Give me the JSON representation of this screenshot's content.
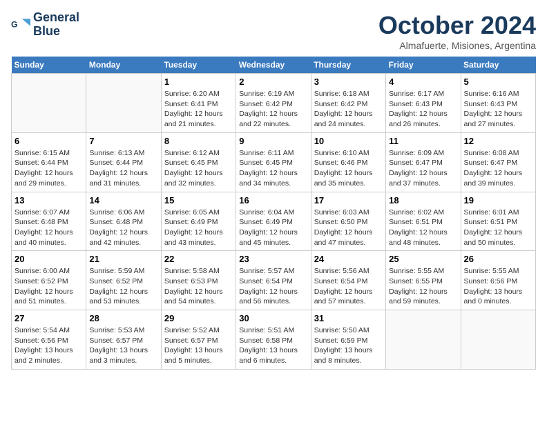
{
  "header": {
    "logo_line1": "General",
    "logo_line2": "Blue",
    "month": "October 2024",
    "location": "Almafuerte, Misiones, Argentina"
  },
  "days_of_week": [
    "Sunday",
    "Monday",
    "Tuesday",
    "Wednesday",
    "Thursday",
    "Friday",
    "Saturday"
  ],
  "weeks": [
    [
      {
        "day": "",
        "empty": true
      },
      {
        "day": "",
        "empty": true
      },
      {
        "day": "1",
        "sunrise": "6:20 AM",
        "sunset": "6:41 PM",
        "daylight": "12 hours and 21 minutes."
      },
      {
        "day": "2",
        "sunrise": "6:19 AM",
        "sunset": "6:42 PM",
        "daylight": "12 hours and 22 minutes."
      },
      {
        "day": "3",
        "sunrise": "6:18 AM",
        "sunset": "6:42 PM",
        "daylight": "12 hours and 24 minutes."
      },
      {
        "day": "4",
        "sunrise": "6:17 AM",
        "sunset": "6:43 PM",
        "daylight": "12 hours and 26 minutes."
      },
      {
        "day": "5",
        "sunrise": "6:16 AM",
        "sunset": "6:43 PM",
        "daylight": "12 hours and 27 minutes."
      }
    ],
    [
      {
        "day": "6",
        "sunrise": "6:15 AM",
        "sunset": "6:44 PM",
        "daylight": "12 hours and 29 minutes."
      },
      {
        "day": "7",
        "sunrise": "6:13 AM",
        "sunset": "6:44 PM",
        "daylight": "12 hours and 31 minutes."
      },
      {
        "day": "8",
        "sunrise": "6:12 AM",
        "sunset": "6:45 PM",
        "daylight": "12 hours and 32 minutes."
      },
      {
        "day": "9",
        "sunrise": "6:11 AM",
        "sunset": "6:45 PM",
        "daylight": "12 hours and 34 minutes."
      },
      {
        "day": "10",
        "sunrise": "6:10 AM",
        "sunset": "6:46 PM",
        "daylight": "12 hours and 35 minutes."
      },
      {
        "day": "11",
        "sunrise": "6:09 AM",
        "sunset": "6:47 PM",
        "daylight": "12 hours and 37 minutes."
      },
      {
        "day": "12",
        "sunrise": "6:08 AM",
        "sunset": "6:47 PM",
        "daylight": "12 hours and 39 minutes."
      }
    ],
    [
      {
        "day": "13",
        "sunrise": "6:07 AM",
        "sunset": "6:48 PM",
        "daylight": "12 hours and 40 minutes."
      },
      {
        "day": "14",
        "sunrise": "6:06 AM",
        "sunset": "6:48 PM",
        "daylight": "12 hours and 42 minutes."
      },
      {
        "day": "15",
        "sunrise": "6:05 AM",
        "sunset": "6:49 PM",
        "daylight": "12 hours and 43 minutes."
      },
      {
        "day": "16",
        "sunrise": "6:04 AM",
        "sunset": "6:49 PM",
        "daylight": "12 hours and 45 minutes."
      },
      {
        "day": "17",
        "sunrise": "6:03 AM",
        "sunset": "6:50 PM",
        "daylight": "12 hours and 47 minutes."
      },
      {
        "day": "18",
        "sunrise": "6:02 AM",
        "sunset": "6:51 PM",
        "daylight": "12 hours and 48 minutes."
      },
      {
        "day": "19",
        "sunrise": "6:01 AM",
        "sunset": "6:51 PM",
        "daylight": "12 hours and 50 minutes."
      }
    ],
    [
      {
        "day": "20",
        "sunrise": "6:00 AM",
        "sunset": "6:52 PM",
        "daylight": "12 hours and 51 minutes."
      },
      {
        "day": "21",
        "sunrise": "5:59 AM",
        "sunset": "6:52 PM",
        "daylight": "12 hours and 53 minutes."
      },
      {
        "day": "22",
        "sunrise": "5:58 AM",
        "sunset": "6:53 PM",
        "daylight": "12 hours and 54 minutes."
      },
      {
        "day": "23",
        "sunrise": "5:57 AM",
        "sunset": "6:54 PM",
        "daylight": "12 hours and 56 minutes."
      },
      {
        "day": "24",
        "sunrise": "5:56 AM",
        "sunset": "6:54 PM",
        "daylight": "12 hours and 57 minutes."
      },
      {
        "day": "25",
        "sunrise": "5:55 AM",
        "sunset": "6:55 PM",
        "daylight": "12 hours and 59 minutes."
      },
      {
        "day": "26",
        "sunrise": "5:55 AM",
        "sunset": "6:56 PM",
        "daylight": "13 hours and 0 minutes."
      }
    ],
    [
      {
        "day": "27",
        "sunrise": "5:54 AM",
        "sunset": "6:56 PM",
        "daylight": "13 hours and 2 minutes."
      },
      {
        "day": "28",
        "sunrise": "5:53 AM",
        "sunset": "6:57 PM",
        "daylight": "13 hours and 3 minutes."
      },
      {
        "day": "29",
        "sunrise": "5:52 AM",
        "sunset": "6:57 PM",
        "daylight": "13 hours and 5 minutes."
      },
      {
        "day": "30",
        "sunrise": "5:51 AM",
        "sunset": "6:58 PM",
        "daylight": "13 hours and 6 minutes."
      },
      {
        "day": "31",
        "sunrise": "5:50 AM",
        "sunset": "6:59 PM",
        "daylight": "13 hours and 8 minutes."
      },
      {
        "day": "",
        "empty": true
      },
      {
        "day": "",
        "empty": true
      }
    ]
  ]
}
